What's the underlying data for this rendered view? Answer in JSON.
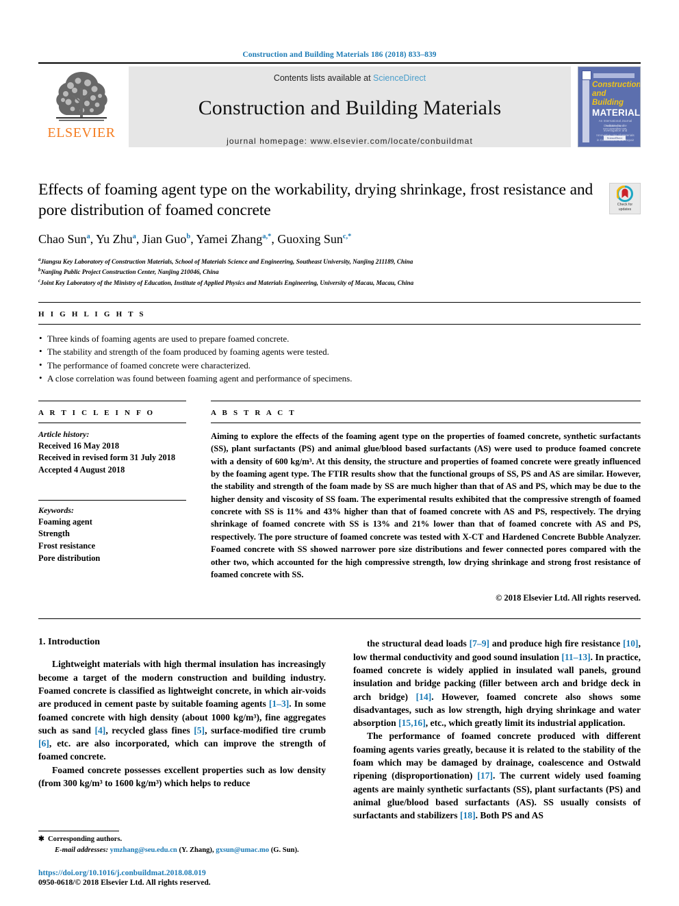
{
  "running_head": "Construction and Building Materials 186 (2018) 833–839",
  "masthead": {
    "publisher_name": "ELSEVIER",
    "contents_prefix": "Contents lists available at ",
    "contents_link": "ScienceDirect",
    "journal_title": "Construction and Building Materials",
    "homepage": "journal homepage: www.elsevier.com/locate/conbuildmat",
    "cover": {
      "line1": "Construction",
      "line2": "and Building",
      "line3": "MATERIALS",
      "subtext": "An International Journal Dedicated to the Investigation and Innovative Use of Materials in Construction and Repair",
      "footer_note": "Available online at www.sciencedirect.com",
      "footer_badge": "ScienceDirect"
    }
  },
  "article": {
    "title": "Effects of foaming agent type on the workability, drying shrinkage, frost resistance and pore distribution of foamed concrete",
    "crossmark": {
      "line1": "Check for",
      "line2": "updates"
    },
    "authors": [
      {
        "name": "Chao Sun",
        "sup": "a"
      },
      {
        "name": "Yu Zhu",
        "sup": "a"
      },
      {
        "name": "Jian Guo",
        "sup": "b"
      },
      {
        "name": "Yamei Zhang",
        "sup": "a,*"
      },
      {
        "name": "Guoxing Sun",
        "sup": "c,*"
      }
    ],
    "affiliations": [
      {
        "mark": "a",
        "text": "Jiangsu Key Laboratory of Construction Materials, School of Materials Science and Engineering, Southeast University, Nanjing 211189, China"
      },
      {
        "mark": "b",
        "text": "Nanjing Public Project Construction Center, Nanjing 210046, China"
      },
      {
        "mark": "c",
        "text": "Joint Key Laboratory of the Ministry of Education, Institute of Applied Physics and Materials Engineering, University of Macau, Macau, China"
      }
    ]
  },
  "highlights": {
    "label": "H I G H L I G H T S",
    "items": [
      "Three kinds of foaming agents are used to prepare foamed concrete.",
      "The stability and strength of the foam produced by foaming agents were tested.",
      "The performance of foamed concrete were characterized.",
      "A close correlation was found between foaming agent and performance of specimens."
    ]
  },
  "article_info": {
    "label": "A R T I C L E   I N F O",
    "history_heading": "Article history:",
    "history": [
      "Received 16 May 2018",
      "Received in revised form 31 July 2018",
      "Accepted 4 August 2018"
    ],
    "keywords_heading": "Keywords:",
    "keywords": [
      "Foaming agent",
      "Strength",
      "Frost resistance",
      "Pore distribution"
    ]
  },
  "abstract": {
    "label": "A B S T R A C T",
    "text": "Aiming to explore the effects of the foaming agent type on the properties of foamed concrete, synthetic surfactants (SS), plant surfactants (PS) and animal glue/blood based surfactants (AS) were used to produce foamed concrete with a density of 600 kg/m³. At this density, the structure and properties of foamed concrete were greatly influenced by the foaming agent type. The FTIR results show that the functional groups of SS, PS and AS are similar. However, the stability and strength of the foam made by SS are much higher than that of AS and PS, which may be due to the higher density and viscosity of SS foam. The experimental results exhibited that the compressive strength of foamed concrete with SS is 11% and 43% higher than that of foamed concrete with AS and PS, respectively. The drying shrinkage of foamed concrete with SS is 13% and 21% lower than that of foamed concrete with AS and PS, respectively. The pore structure of foamed concrete was tested with X-CT and Hardened Concrete Bubble Analyzer. Foamed concrete with SS showed narrower pore size distributions and fewer connected pores compared with the other two, which accounted for the high compressive strength, low drying shrinkage and strong frost resistance of foamed concrete with SS.",
    "copyright": "© 2018 Elsevier Ltd. All rights reserved."
  },
  "body": {
    "section_title": "1. Introduction",
    "left_paragraphs": [
      "Lightweight materials with high thermal insulation has increasingly become a target of the modern construction and building industry. Foamed concrete is classified as lightweight concrete, in which air-voids are produced in cement paste by suitable foaming agents [1–3]. In some foamed concrete with high density (about 1000 kg/m³), fine aggregates such as sand [4], recycled glass fines [5], surface-modified tire crumb [6], etc. are also incorporated, which can improve the strength of foamed concrete.",
      "Foamed concrete possesses excellent properties such as low density (from 300 kg/m³ to 1600 kg/m³) which helps to reduce"
    ],
    "right_paragraphs": [
      "the structural dead loads [7–9] and produce high fire resistance [10], low thermal conductivity and good sound insulation [11–13]. In practice, foamed concrete is widely applied in insulated wall panels, ground insulation and bridge packing (filler between arch and bridge deck in arch bridge) [14]. However, foamed concrete also shows some disadvantages, such as low strength, high drying shrinkage and water absorption [15,16], etc., which greatly limit its industrial application.",
      "The performance of foamed concrete produced with different foaming agents varies greatly, because it is related to the stability of the foam which may be damaged by drainage, coalescence and Ostwald ripening (disproportionation) [17]. The current widely used foaming agents are mainly synthetic surfactants (SS), plant surfactants (PS) and animal glue/blood based surfactants (AS). SS usually consists of surfactants and stabilizers [18]. Both PS and AS"
    ]
  },
  "footer": {
    "corresponding_label": "Corresponding authors.",
    "email_label": "E-mail addresses:",
    "email1": "ymzhang@seu.edu.cn",
    "email1_owner": "(Y. Zhang)",
    "email2": "gxsun@umac.mo",
    "email2_owner": "(G. Sun)",
    "doi": "https://doi.org/10.1016/j.conbuildmat.2018.08.019",
    "issn": "0950-0618/© 2018 Elsevier Ltd. All rights reserved."
  },
  "colors": {
    "link_blue": "#1b7ab5",
    "sciencedirect_blue": "#4a9ecb",
    "elsevier_orange": "#f47c20",
    "band_gray": "#e6e6e6",
    "cover_blue": "#5c6fae",
    "cover_yellow": "#f0c419"
  }
}
